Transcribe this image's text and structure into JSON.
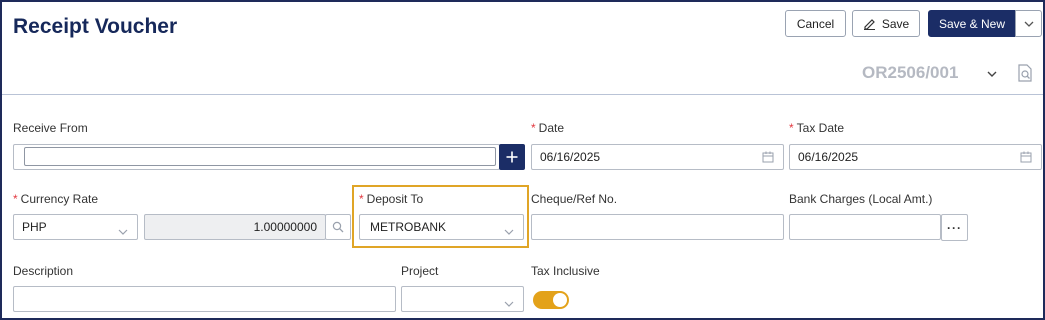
{
  "header": {
    "title": "Receipt Voucher",
    "cancel_label": "Cancel",
    "save_label": "Save",
    "save_new_label": "Save & New",
    "voucher_number": "OR2506/001"
  },
  "form": {
    "receive_from": {
      "label": "Receive From",
      "value": ""
    },
    "date": {
      "label": "Date",
      "required": true,
      "value": "06/16/2025"
    },
    "tax_date": {
      "label": "Tax Date",
      "required": true,
      "value": "06/16/2025"
    },
    "currency_rate": {
      "label": "Currency Rate",
      "required": true,
      "currency": "PHP",
      "rate": "1.00000000"
    },
    "deposit_to": {
      "label": "Deposit To",
      "required": true,
      "value": "METROBANK"
    },
    "cheque_ref": {
      "label": "Cheque/Ref No.",
      "value": ""
    },
    "bank_charges": {
      "label": "Bank Charges (Local Amt.)",
      "value": ""
    },
    "description": {
      "label": "Description",
      "value": ""
    },
    "project": {
      "label": "Project",
      "value": ""
    },
    "tax_inclusive": {
      "label": "Tax Inclusive",
      "on": true
    }
  },
  "icons": {
    "save": "pencil-icon",
    "dropdown": "chevron-down-icon",
    "date": "calendar-icon",
    "search": "search-icon",
    "add": "plus-icon",
    "document": "document-search-icon"
  },
  "colors": {
    "primary": "#1b2d66",
    "title": "#16285a",
    "required": "#e2383f",
    "highlight": "#e0a526",
    "toggle_on": "#e3a21a"
  }
}
